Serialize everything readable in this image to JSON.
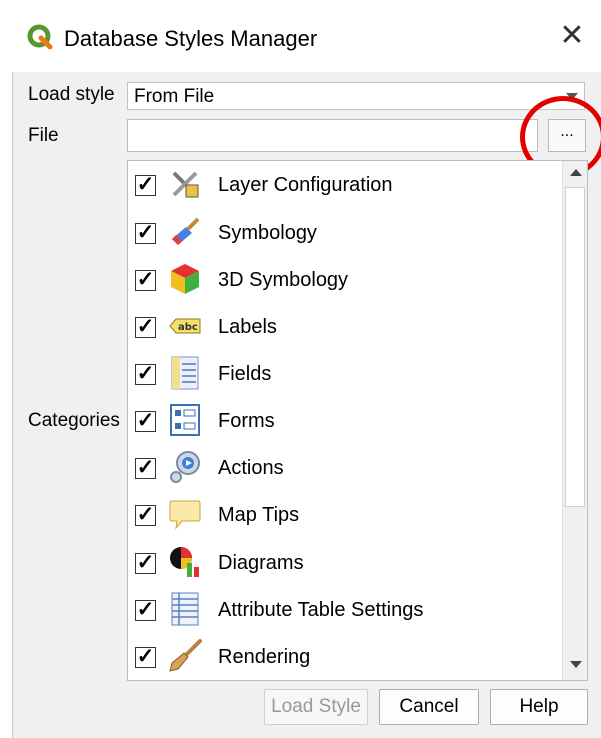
{
  "window": {
    "title": "Database Styles Manager",
    "close_symbol": "✕"
  },
  "form": {
    "load_style_label": "Load style",
    "load_style_value": "From File",
    "file_label": "File",
    "file_value": "",
    "browse_label": "...",
    "categories_label": "Categories"
  },
  "categories": [
    {
      "label": "Layer Configuration",
      "checked": true,
      "icon": "layer-configuration-icon"
    },
    {
      "label": "Symbology",
      "checked": true,
      "icon": "symbology-icon"
    },
    {
      "label": "3D Symbology",
      "checked": true,
      "icon": "3d-symbology-icon"
    },
    {
      "label": "Labels",
      "checked": true,
      "icon": "labels-icon"
    },
    {
      "label": "Fields",
      "checked": true,
      "icon": "fields-icon"
    },
    {
      "label": "Forms",
      "checked": true,
      "icon": "forms-icon"
    },
    {
      "label": "Actions",
      "checked": true,
      "icon": "actions-icon"
    },
    {
      "label": "Map Tips",
      "checked": true,
      "icon": "map-tips-icon"
    },
    {
      "label": "Diagrams",
      "checked": true,
      "icon": "diagrams-icon"
    },
    {
      "label": "Attribute Table Settings",
      "checked": true,
      "icon": "attribute-table-icon"
    },
    {
      "label": "Rendering",
      "checked": true,
      "icon": "rendering-icon"
    }
  ],
  "buttons": {
    "load_style": "Load Style",
    "cancel": "Cancel",
    "help": "Help"
  },
  "annotation_color": "#e30000"
}
